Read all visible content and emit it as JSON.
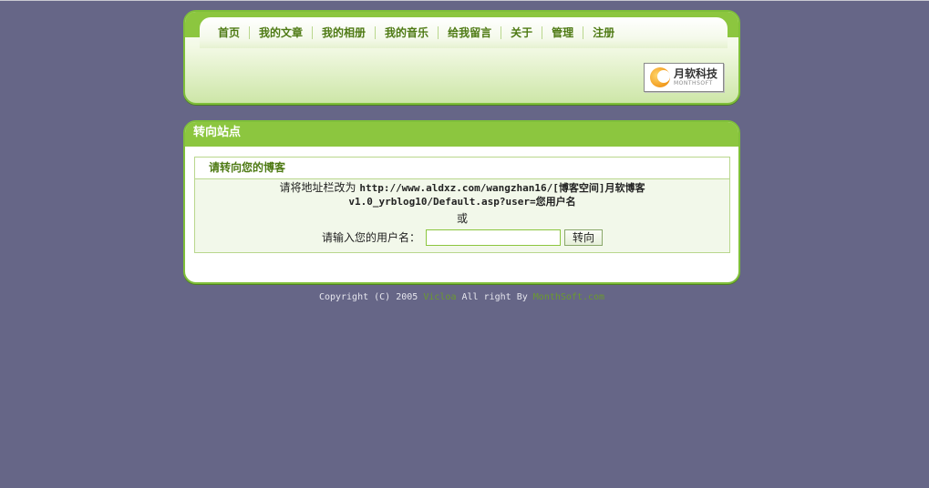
{
  "nav": {
    "items": [
      {
        "label": "首页"
      },
      {
        "label": "我的文章"
      },
      {
        "label": "我的相册"
      },
      {
        "label": "我的音乐"
      },
      {
        "label": "给我留言"
      },
      {
        "label": "关于"
      },
      {
        "label": "管理"
      },
      {
        "label": "注册"
      }
    ]
  },
  "logo": {
    "cn": "月软科技",
    "en": "MONTHSOFT"
  },
  "panel": {
    "title": "转向站点",
    "box_title": "请转向您的博客",
    "hint_prefix": "请将地址栏改为",
    "url_line1": "http://www.aldxz.com/wangzhan16/[博客空间]月软博客",
    "url_line2": "v1.0_yrblog10/Default.asp?user=您用户名",
    "or": "或",
    "input_label": "请输入您的用户名：",
    "input_value": "",
    "button_label": "转向"
  },
  "footer": {
    "prefix": "Copyright (C) 2005",
    "link1": "Vicloa",
    "middle": "All right By",
    "link2": "MonthSoft.com"
  },
  "colors": {
    "background": "#666687",
    "accent": "#8cc63f",
    "nav_text": "#4e7a14"
  }
}
